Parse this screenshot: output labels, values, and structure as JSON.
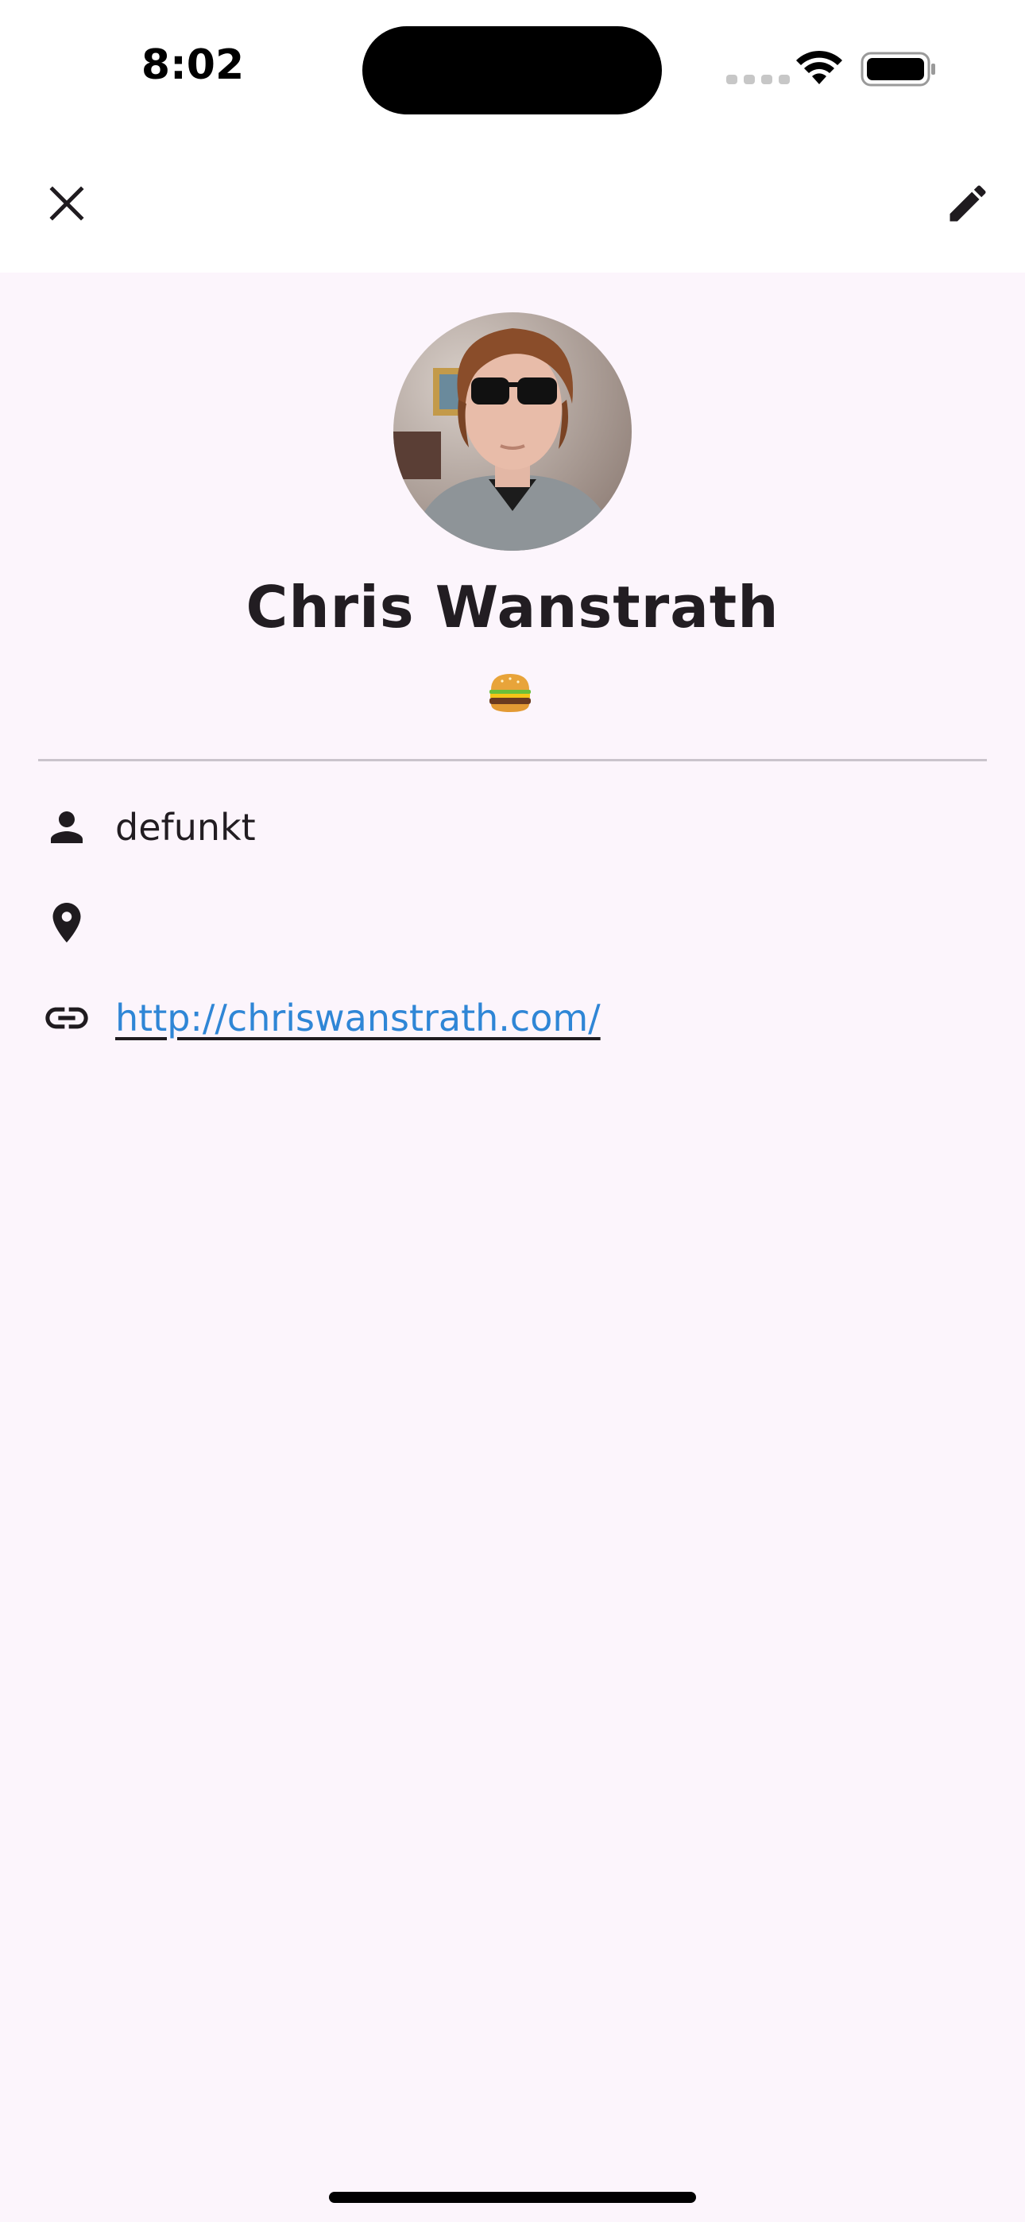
{
  "status_bar": {
    "time": "8:02"
  },
  "app_bar": {
    "close_icon": "close-icon",
    "edit_icon": "pencil-icon"
  },
  "profile": {
    "name": "Chris Wanstrath",
    "status_emoji": "hamburger-emoji",
    "username": "defunkt",
    "location": "",
    "website": "http://chriswanstrath.com/"
  },
  "colors": {
    "background": "#fcf5fc",
    "link": "#2f86d6",
    "text": "#1f1b1f",
    "divider": "#cac4cc"
  }
}
